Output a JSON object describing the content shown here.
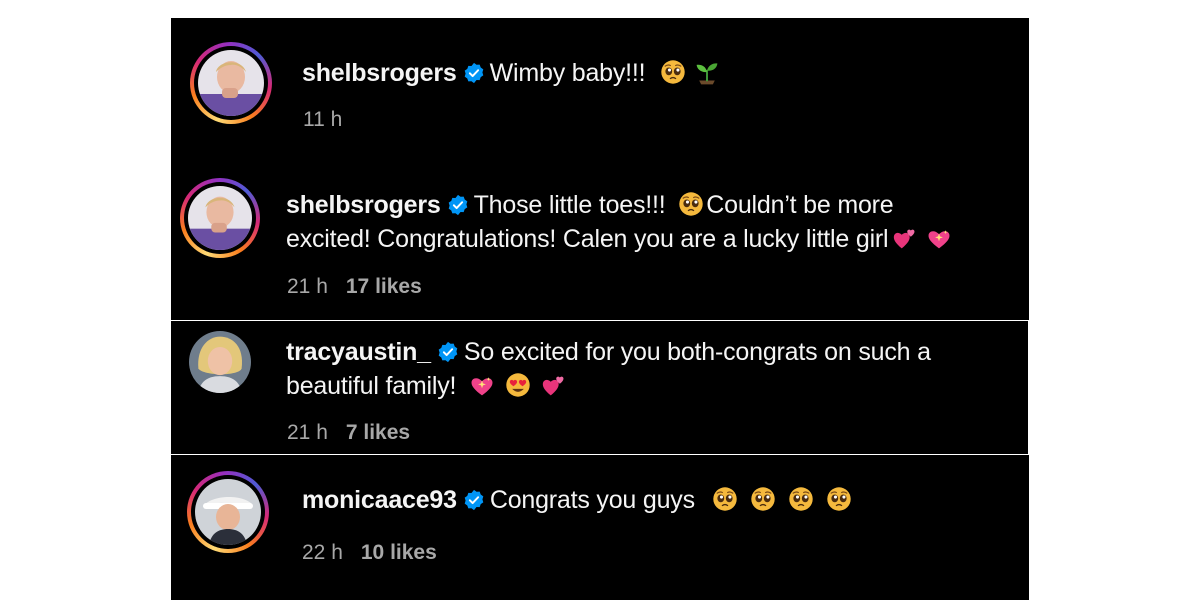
{
  "colors": {
    "panel_bg": "#000000",
    "text": "#f5f5f5",
    "meta": "#a8a8a8",
    "verified": "#0095f6"
  },
  "comments": [
    {
      "username": "shelbsrogers",
      "verified": true,
      "text_parts": [
        "Wimby baby!!!"
      ],
      "emojis": [
        "pleading-face-emoji",
        "seedling-emoji"
      ],
      "time": "11 h",
      "likes": ""
    },
    {
      "username": "shelbsrogers",
      "verified": true,
      "text_parts": [
        "Those little toes!!!",
        "Couldn’t be more",
        "excited! Congratulations! Calen you are a lucky little girl"
      ],
      "emojis": [
        "pleading-face-emoji",
        "two-hearts-emoji",
        "sparkling-heart-emoji"
      ],
      "time": "21 h",
      "likes": "17 likes"
    },
    {
      "username": "tracyaustin_",
      "verified": true,
      "text_parts": [
        "So excited for you both-congrats on such a",
        "beautiful family!"
      ],
      "emojis": [
        "sparkling-heart-emoji",
        "heart-eyes-emoji",
        "two-hearts-emoji"
      ],
      "time": "21 h",
      "likes": "7 likes"
    },
    {
      "username": "monicaace93",
      "verified": true,
      "text_parts": [
        "Congrats you guys"
      ],
      "emojis": [
        "pleading-face-emoji",
        "pleading-face-emoji",
        "pleading-face-emoji",
        "pleading-face-emoji"
      ],
      "time": "22 h",
      "likes": "10 likes"
    }
  ]
}
